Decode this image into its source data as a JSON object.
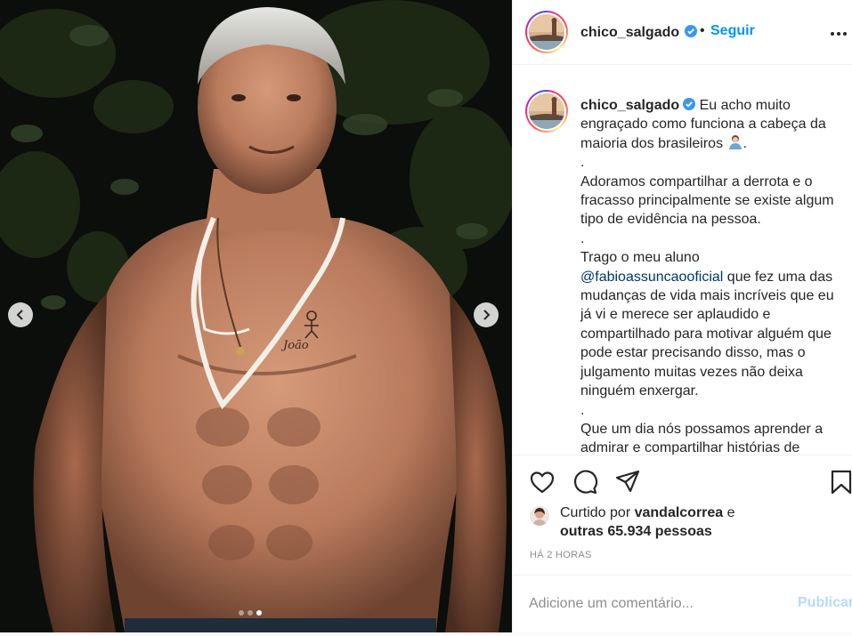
{
  "post": {
    "username": "chico_salgado",
    "verified": true,
    "follow_separator": "•",
    "follow_label": "Seguir",
    "more_label": "more-options",
    "media": {
      "carousel_count": 3,
      "active_index": 2,
      "tattoo_text": "João"
    },
    "caption": {
      "username": "chico_salgado",
      "line1": " Eu acho muito engraçado como funciona a cabeça da maioria dos brasileiros ",
      "line1_end": ".",
      "dot1": ".",
      "para2": "Adoramos compartilhar a derrota e o fracasso principalmente se existe algum tipo de evidência na pessoa.",
      "dot2": ".",
      "para3_a": "Trago o meu aluno",
      "mention": "@fabioassuncaooficial",
      "para3_b": " que fez uma das mudanças de vida mais incríveis que eu já vi e merece ser aplaudido e compartilhado para motivar alguém que pode estar precisando disso, mas o julgamento muitas vezes não deixa ninguém enxergar.",
      "dot3": ".",
      "para4": "Que um dia nós possamos aprender a admirar e compartilhar histórias de"
    },
    "actions": {
      "like_icon": "heart-icon",
      "comment_icon": "comment-icon",
      "share_icon": "share-icon",
      "save_icon": "bookmark-icon"
    },
    "likes": {
      "prefix": "Curtido por ",
      "liked_by": "vandalcorrea",
      "conj": " e",
      "others": "outras 65.934 pessoas"
    },
    "time": "HÁ 2 HORAS",
    "comment": {
      "placeholder": "Adicione um comentário...",
      "publish_label": "Publicar"
    }
  },
  "colors": {
    "accent": "#0095f6",
    "text": "#262626",
    "muted": "#8e8e8e",
    "mention": "#00376b",
    "publish_disabled": "#b3dbff",
    "border": "#efefef"
  }
}
